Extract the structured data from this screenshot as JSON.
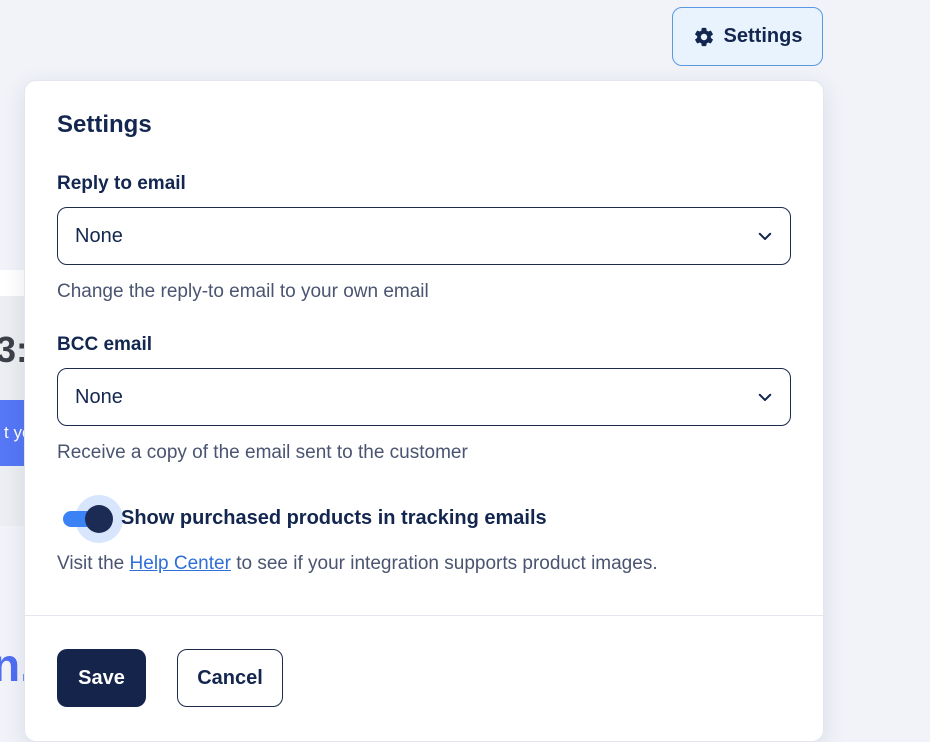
{
  "background": {
    "fragment_digit": "3:",
    "fragment_button_text": "t yo",
    "fragment_heading": "n."
  },
  "settings_button": {
    "label": "Settings",
    "icon": "gear-icon"
  },
  "panel": {
    "title": "Settings",
    "reply_to": {
      "label": "Reply to email",
      "value": "None",
      "help": "Change the reply-to email to your own email"
    },
    "bcc": {
      "label": "BCC email",
      "value": "None",
      "help": "Receive a copy of the email sent to the customer"
    },
    "toggle": {
      "label": "Show purchased products in tracking emails",
      "checked": true
    },
    "info": {
      "prefix": "Visit the ",
      "link": "Help Center",
      "suffix": " to see if your integration supports product images."
    },
    "save_label": "Save",
    "cancel_label": "Cancel"
  },
  "colors": {
    "primary": "#14244b",
    "accent": "#3b82f6",
    "link": "#2f6fd6"
  }
}
